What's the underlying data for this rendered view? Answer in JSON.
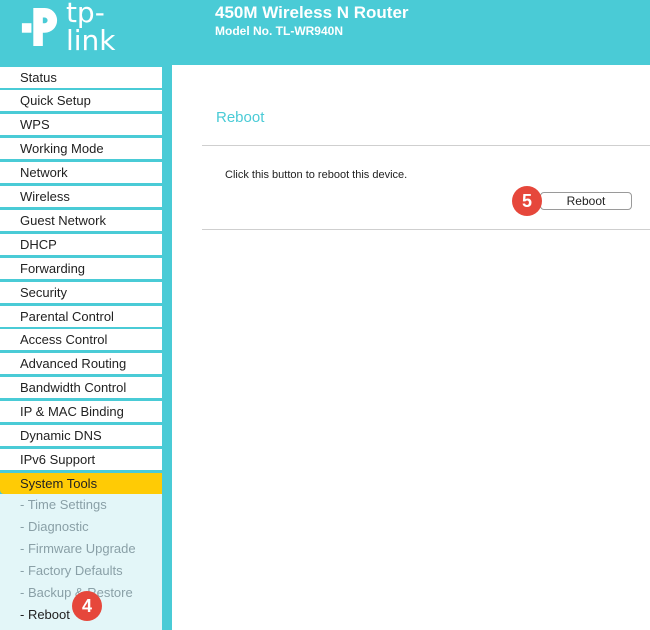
{
  "header": {
    "logo_text": "tp-link",
    "product_title": "450M Wireless N Router",
    "model_no": "Model No. TL-WR940N",
    "brand_color": "#4acbd6"
  },
  "sidebar": {
    "items": [
      {
        "label": "Status"
      },
      {
        "label": "Quick Setup"
      },
      {
        "label": "WPS"
      },
      {
        "label": "Working Mode"
      },
      {
        "label": "Network"
      },
      {
        "label": "Wireless"
      },
      {
        "label": "Guest Network"
      },
      {
        "label": "DHCP"
      },
      {
        "label": "Forwarding"
      },
      {
        "label": "Security"
      },
      {
        "label": "Parental Control"
      },
      {
        "label": "Access Control"
      },
      {
        "label": "Advanced Routing"
      },
      {
        "label": "Bandwidth Control"
      },
      {
        "label": "IP & MAC Binding"
      },
      {
        "label": "Dynamic DNS"
      },
      {
        "label": "IPv6 Support"
      },
      {
        "label": "System Tools",
        "active": true
      }
    ],
    "subitems": [
      {
        "label": "- Time Settings"
      },
      {
        "label": "- Diagnostic"
      },
      {
        "label": "- Firmware Upgrade"
      },
      {
        "label": "- Factory Defaults"
      },
      {
        "label": "- Backup & Restore"
      },
      {
        "label": "- Reboot",
        "current": true
      }
    ],
    "active_color": "#ffcb05"
  },
  "main": {
    "title": "Reboot",
    "description": "Click this button to reboot this device.",
    "reboot_button_label": "Reboot"
  },
  "annotations": {
    "step4": "4",
    "step5": "5",
    "badge_color": "#e6473b"
  }
}
